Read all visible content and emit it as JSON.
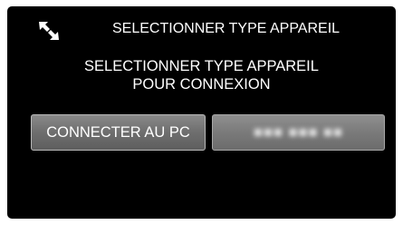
{
  "header": {
    "icon": "usb-connection-icon",
    "title": "SELECTIONNER TYPE APPAREIL"
  },
  "prompt": {
    "line1": "SELECTIONNER TYPE APPAREIL",
    "line2": "POUR CONNEXION"
  },
  "buttons": {
    "connect_pc_label": "CONNECTER AU PC",
    "other_label": "■■■ ■■■ ■■"
  },
  "colors": {
    "screen_background": "#000000",
    "button_background": "#707070",
    "text": "#ffffff"
  }
}
